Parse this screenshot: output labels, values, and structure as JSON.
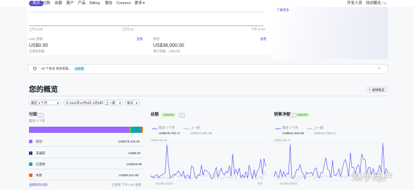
{
  "colors": {
    "accent": "#5a4fcf",
    "purple": "#9966ff",
    "navy": "#2c3e8f",
    "teal": "#0fa4b7",
    "orange": "#e66a1e",
    "green": "#6cbf3b"
  },
  "nav": {
    "items": [
      "首页",
      "付款",
      "余额",
      "客户",
      "产品",
      "Billing",
      "报告",
      "Connect",
      "更多"
    ],
    "more_chevron": "▾",
    "developer": "开发人员",
    "test_data": "测试模式"
  },
  "top": {
    "times": [
      "上午12:00",
      "上午8:12",
      "下午11:59"
    ],
    "view_report": "了解更多",
    "usd_balance": {
      "label": "USD 余额",
      "value": "US$0.00",
      "sub": "已预估余额",
      "link": "查看"
    },
    "payouts": {
      "label": "提现",
      "value": "US$38,000.00",
      "sub": "预计到账：1月10日",
      "link": "查看"
    }
  },
  "notice": {
    "text": "20 个争议 尚未答复。",
    "badge": "去处理"
  },
  "overview": {
    "title": "您的概览",
    "edit": "编辑概览",
    "range": "最近 3 个月",
    "date_range": "2022年11月9日–2月8日",
    "compare": "上一期",
    "interval": "每天"
  },
  "payments": {
    "title": "付款",
    "subtitle": "最近 3 个月",
    "bar": [
      0.88,
      0.02,
      0.08,
      0.02
    ],
    "rows": [
      {
        "label": "成功",
        "value": "US$578,316.29"
      },
      {
        "label": "未捕获",
        "value": "US$0.00"
      },
      {
        "label": "已退款",
        "value": "US$535.88"
      },
      {
        "label": "失败",
        "value": "US$58,201.68"
      }
    ],
    "footer_link": "查看所有付款",
    "footer_note": "已更新 下午7:00 查看"
  },
  "gross": {
    "title": "总额",
    "badge": "+164.5%",
    "legend_cur": "最近 3 个月",
    "legend_prev": "上一期",
    "cur": "US$578,752.17",
    "prev": "US$127,591.55",
    "y_top": "US$54,994.90",
    "x_left": "2022年11月9日",
    "x_right": "今天"
  },
  "net": {
    "title": "销售净额",
    "badge": "+345.9%",
    "legend_cur": "最近 3 个月",
    "legend_prev": "上一期",
    "cur": "US$542,945.99",
    "prev": "US$121,759.14",
    "y_top": "US$53,681.71",
    "x_left": "2022年11月9日",
    "x_right": "今天"
  },
  "watermark": "知乎用户"
}
